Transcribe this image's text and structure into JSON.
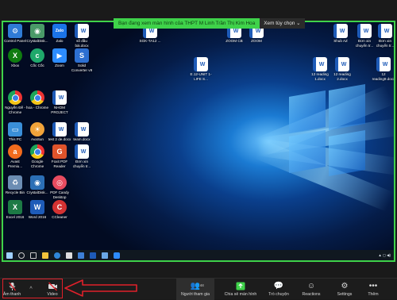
{
  "share_banner": {
    "message": "Bạn đang xem màn hình của THPT M Linh Trần Thị Kim Hoa",
    "view_options": "Xem tùy chọn"
  },
  "desktop": {
    "icons_col1": [
      {
        "label": "Control Panel",
        "icon": "control-panel-icon",
        "color": "#2f7bd6"
      },
      {
        "label": "Xbox",
        "icon": "xbox-icon",
        "color": "#107c10"
      },
      {
        "label": "Nguyễn Đế - Chrome",
        "icon": "chrome-icon",
        "color": ""
      },
      {
        "label": "This PC",
        "icon": "computer-icon",
        "color": "#3a8fd8"
      },
      {
        "label": "Avast Premiu...",
        "icon": "avast-icon",
        "color": "#f26b1d"
      },
      {
        "label": "Recycle Bin",
        "icon": "recycle-bin-icon",
        "color": "#6c8db3"
      },
      {
        "label": "Excel 2016",
        "icon": "excel-icon",
        "color": "#1d7a45"
      }
    ],
    "icons_col2": [
      {
        "label": "CrystalDisk...",
        "icon": "crystaldisk-icon",
        "color": "#4a9a68"
      },
      {
        "label": "Cốc Cốc",
        "icon": "coccoc-icon",
        "color": "#1fa86b"
      },
      {
        "label": "hoa - Chrome",
        "icon": "chrome-icon",
        "color": ""
      },
      {
        "label": "AvaSun",
        "icon": "avasun-icon",
        "color": "#f1a33a"
      },
      {
        "label": "Google Chrome",
        "icon": "chrome-icon",
        "color": ""
      },
      {
        "label": "CrystalDisk...",
        "icon": "crystaldisk-icon",
        "color": "#2b6fb6"
      },
      {
        "label": "Word 2016",
        "icon": "word-icon",
        "color": "#1e5bb8"
      }
    ],
    "icons_col3": [
      {
        "label": "Zalo",
        "icon": "zalo-icon",
        "color": "#1b74e8"
      },
      {
        "label": "Zoom",
        "icon": "zoom-icon",
        "color": "#2d8cff"
      },
      {
        "label": "NHOM PROJECT",
        "icon": "word-icon",
        "color": "#1e5bb8"
      },
      {
        "label": "test 2 de.docx",
        "icon": "word-icon",
        "color": "#1e5bb8"
      },
      {
        "label": "Foxit PDF Reader",
        "icon": "foxit-icon",
        "color": "#e0532b"
      },
      {
        "label": "PDF Candy Desktop",
        "icon": "pdfcandy-icon",
        "color": "#e84c60"
      },
      {
        "label": "CCleaner",
        "icon": "ccleaner-icon",
        "color": "#d43232"
      }
    ],
    "icons_col4": [
      {
        "label": "số đầu bài.docx",
        "icon": "word-icon",
        "color": "#1e5bb8"
      },
      {
        "label": "Solid Converter v9",
        "icon": "solid-converter-icon",
        "color": "#2d6fd1"
      },
      {
        "label": "team.docx",
        "icon": "word-icon",
        "color": "#1e5bb8"
      },
      {
        "label": "Đơn xin chuyển tr...",
        "icon": "word-icon",
        "color": "#1e5bb8"
      }
    ],
    "icons_top": [
      {
        "label": "SGK-TA12 ...",
        "icon": "word-icon"
      },
      {
        "label": "ZOOM CB",
        "icon": "word-icon"
      },
      {
        "label": "ZOOM",
        "icon": "word-icon"
      },
      {
        "label": "Shub AZ",
        "icon": "word-icon"
      },
      {
        "label": "Đơn xin chuyển tr...",
        "icon": "word-icon"
      },
      {
        "label": "Đơn xin chuyển tr...",
        "icon": "word-icon"
      }
    ],
    "icons_mid": [
      {
        "label": "E.12-UNIT 1-LIFE S...",
        "icon": "word-icon"
      },
      {
        "label": "12 reading 1.docx",
        "icon": "word-icon"
      },
      {
        "label": "12 reading 2.docx",
        "icon": "word-icon"
      },
      {
        "label": "12 reading9.docx",
        "icon": "word-icon"
      }
    ]
  },
  "toolbar": {
    "audio_label": "Âm thanh",
    "video_label": "Video",
    "participants_label": "Người tham gia",
    "participants_count": "44",
    "share_label": "Chia sẻ màn hình",
    "chat_label": "Trò chuyện",
    "reactions_label": "Reactions",
    "settings_label": "Settings",
    "more_label": "Thêm"
  },
  "colors": {
    "share_green": "#3fd24a",
    "annotation_red": "#e0202a",
    "toolbar_bg": "#1c1c1c"
  }
}
